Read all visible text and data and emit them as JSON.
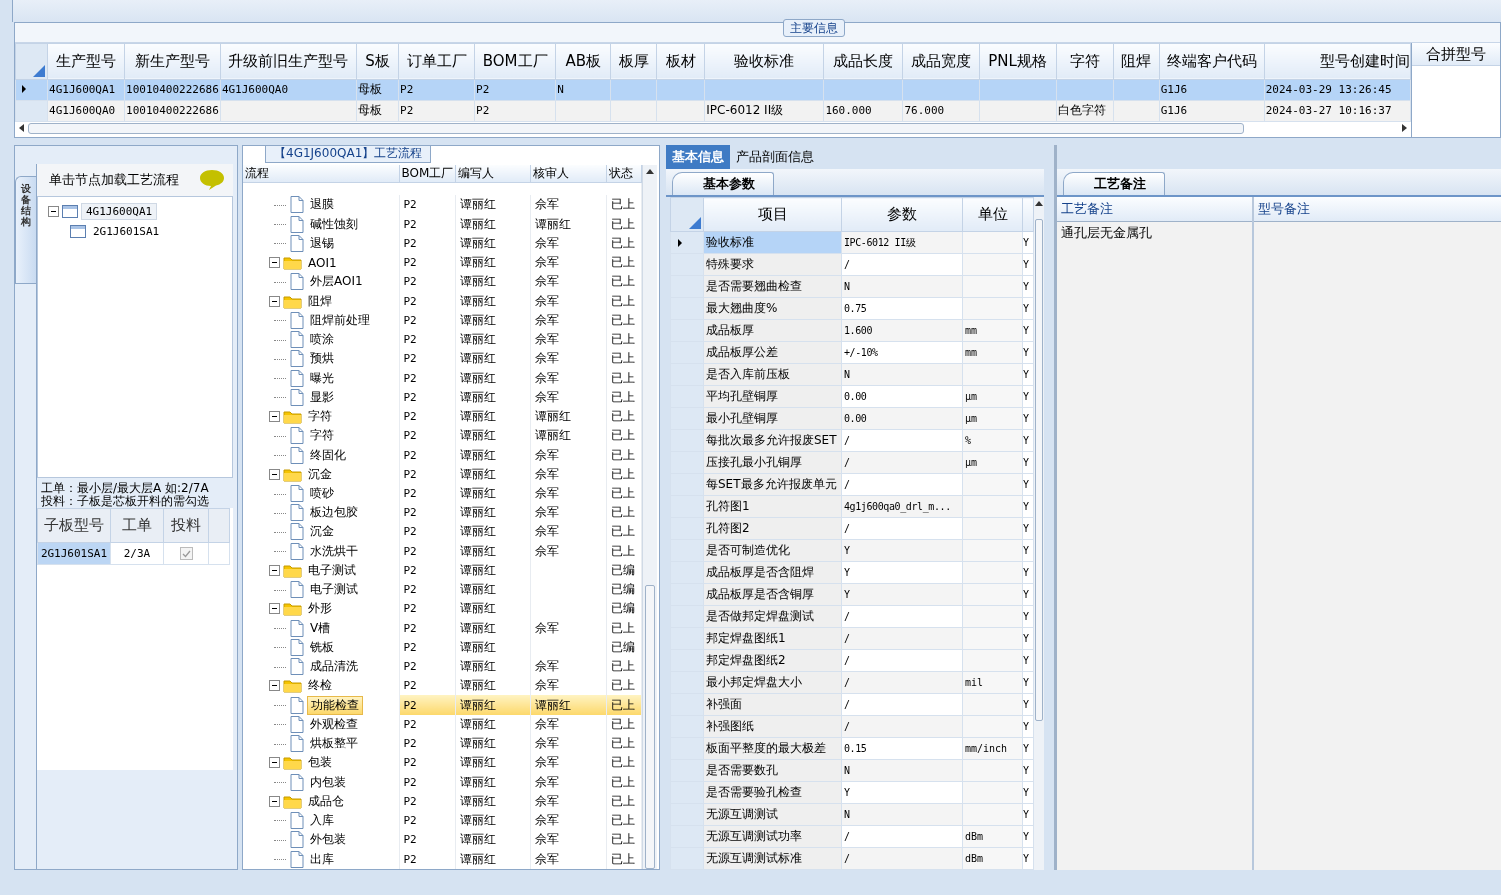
{
  "main_info": {
    "title": "主要信息",
    "columns": [
      "生产型号",
      "新生产型号",
      "升级前旧生产型号",
      "S板",
      "订单工厂",
      "BOM工厂",
      "AB板",
      "板厚",
      "板材",
      "验收标准",
      "成品长度",
      "成品宽度",
      "PNL规格",
      "字符",
      "阻焊",
      "终端客户代码",
      "型号创建时间"
    ],
    "rows": [
      {
        "selected": true,
        "cells": [
          "4G1J600QA1",
          "10010400222686",
          "4G1J600QA0",
          "母板",
          "P2",
          "P2",
          "N",
          "",
          "",
          "",
          "",
          "",
          "",
          "",
          "",
          "G1J6",
          "2024-03-29 13:26:45"
        ]
      },
      {
        "selected": false,
        "cells": [
          "4G1J600QA0",
          "10010400222686",
          "",
          "母板",
          "P2",
          "P2",
          "",
          "",
          "",
          "IPC-6012 II级",
          "160.000",
          "76.000",
          "",
          "白色字符",
          "",
          "G1J6",
          "2024-03-27 10:16:37"
        ]
      }
    ]
  },
  "merge_panel": {
    "title": "合拼型号"
  },
  "structure": {
    "side_tab": "设备结构",
    "hint": "单击节点加载工艺流程",
    "tree": [
      {
        "label": "4G1J600QA1",
        "selected": true,
        "expanded": true,
        "children": [
          {
            "label": "2G1J601SA1",
            "selected": false
          }
        ]
      }
    ],
    "notes": [
      "工单：最小层/最大层A 如:2/7A",
      "投料：子板是芯板开料的需勾选"
    ],
    "sub_table": {
      "columns": [
        "子板型号",
        "工单",
        "投料"
      ],
      "rows": [
        {
          "cells": [
            "2G1J601SA1",
            "2/3A"
          ],
          "checked": true
        }
      ]
    }
  },
  "process": {
    "title": "【4G1J600QA1】工艺流程",
    "columns": [
      "流程",
      "BOM工厂",
      "编写人",
      "核审人",
      "状态"
    ],
    "rows": [
      {
        "expanded": true,
        "children": [
          {
            "name": "退膜",
            "bom": "P2",
            "writer": "谭丽红",
            "reviewer": "佘军",
            "status": "已上",
            "selected": false
          },
          {
            "name": "碱性蚀刻",
            "bom": "P2",
            "writer": "谭丽红",
            "reviewer": "谭丽红",
            "status": "已上",
            "selected": false
          },
          {
            "name": "退锡",
            "bom": "P2",
            "writer": "谭丽红",
            "reviewer": "佘军",
            "status": "已上",
            "selected": false
          }
        ]
      },
      {
        "name": "AOI1",
        "bom": "P2",
        "writer": "谭丽红",
        "reviewer": "佘军",
        "status": "已上",
        "expanded": true,
        "selected": false,
        "children": [
          {
            "name": "外层AOI1",
            "bom": "P2",
            "writer": "谭丽红",
            "reviewer": "佘军",
            "status": "已上",
            "selected": false
          }
        ]
      },
      {
        "name": "阻焊",
        "bom": "P2",
        "writer": "谭丽红",
        "reviewer": "佘军",
        "status": "已上",
        "expanded": true,
        "selected": false,
        "children": [
          {
            "name": "阻焊前处理",
            "bom": "P2",
            "writer": "谭丽红",
            "reviewer": "佘军",
            "status": "已上",
            "selected": false
          },
          {
            "name": "喷涂",
            "bom": "P2",
            "writer": "谭丽红",
            "reviewer": "佘军",
            "status": "已上",
            "selected": false
          },
          {
            "name": "预烘",
            "bom": "P2",
            "writer": "谭丽红",
            "reviewer": "佘军",
            "status": "已上",
            "selected": false
          },
          {
            "name": "曝光",
            "bom": "P2",
            "writer": "谭丽红",
            "reviewer": "佘军",
            "status": "已上",
            "selected": false
          },
          {
            "name": "显影",
            "bom": "P2",
            "writer": "谭丽红",
            "reviewer": "佘军",
            "status": "已上",
            "selected": false
          }
        ]
      },
      {
        "name": "字符",
        "bom": "P2",
        "writer": "谭丽红",
        "reviewer": "谭丽红",
        "status": "已上",
        "expanded": true,
        "selected": false,
        "children": [
          {
            "name": "字符",
            "bom": "P2",
            "writer": "谭丽红",
            "reviewer": "谭丽红",
            "status": "已上",
            "selected": false
          },
          {
            "name": "终固化",
            "bom": "P2",
            "writer": "谭丽红",
            "reviewer": "佘军",
            "status": "已上",
            "selected": false
          }
        ]
      },
      {
        "name": "沉金",
        "bom": "P2",
        "writer": "谭丽红",
        "reviewer": "佘军",
        "status": "已上",
        "expanded": true,
        "selected": false,
        "children": [
          {
            "name": "喷砂",
            "bom": "P2",
            "writer": "谭丽红",
            "reviewer": "佘军",
            "status": "已上",
            "selected": false
          },
          {
            "name": "板边包胶",
            "bom": "P2",
            "writer": "谭丽红",
            "reviewer": "佘军",
            "status": "已上",
            "selected": false
          },
          {
            "name": "沉金",
            "bom": "P2",
            "writer": "谭丽红",
            "reviewer": "佘军",
            "status": "已上",
            "selected": false
          },
          {
            "name": "水洗烘干",
            "bom": "P2",
            "writer": "谭丽红",
            "reviewer": "佘军",
            "status": "已上",
            "selected": false
          }
        ]
      },
      {
        "name": "电子测试",
        "bom": "P2",
        "writer": "谭丽红",
        "status": "已编",
        "expanded": true,
        "selected": false,
        "children": [
          {
            "name": "电子测试",
            "bom": "P2",
            "writer": "谭丽红",
            "status": "已编",
            "selected": false
          }
        ]
      },
      {
        "name": "外形",
        "bom": "P2",
        "writer": "谭丽红",
        "status": "已编",
        "expanded": true,
        "selected": false,
        "children": [
          {
            "name": "V槽",
            "bom": "P2",
            "writer": "谭丽红",
            "reviewer": "佘军",
            "status": "已上",
            "selected": false
          },
          {
            "name": "铣板",
            "bom": "P2",
            "writer": "谭丽红",
            "status": "已编",
            "selected": false
          },
          {
            "name": "成品清洗",
            "bom": "P2",
            "writer": "谭丽红",
            "reviewer": "佘军",
            "status": "已上",
            "selected": false
          }
        ]
      },
      {
        "name": "终检",
        "bom": "P2",
        "writer": "谭丽红",
        "reviewer": "佘军",
        "status": "已上",
        "expanded": true,
        "selected": false,
        "children": [
          {
            "name": "功能检查",
            "bom": "P2",
            "writer": "谭丽红",
            "reviewer": "谭丽红",
            "status": "已上",
            "selected": true
          },
          {
            "name": "外观检查",
            "bom": "P2",
            "writer": "谭丽红",
            "reviewer": "佘军",
            "status": "已上",
            "selected": false
          },
          {
            "name": "烘板整平",
            "bom": "P2",
            "writer": "谭丽红",
            "reviewer": "佘军",
            "status": "已上",
            "selected": false
          }
        ]
      },
      {
        "name": "包装",
        "bom": "P2",
        "writer": "谭丽红",
        "reviewer": "佘军",
        "status": "已上",
        "expanded": true,
        "selected": false,
        "children": [
          {
            "name": "内包装",
            "bom": "P2",
            "writer": "谭丽红",
            "reviewer": "佘军",
            "status": "已上",
            "selected": false
          }
        ]
      },
      {
        "name": "成品仓",
        "bom": "P2",
        "writer": "谭丽红",
        "reviewer": "佘军",
        "status": "已上",
        "expanded": true,
        "selected": false,
        "children": [
          {
            "name": "入库",
            "bom": "P2",
            "writer": "谭丽红",
            "reviewer": "佘军",
            "status": "已上",
            "selected": false
          },
          {
            "name": "外包装",
            "bom": "P2",
            "writer": "谭丽红",
            "reviewer": "佘军",
            "status": "已上",
            "selected": false
          },
          {
            "name": "出库",
            "bom": "P2",
            "writer": "谭丽红",
            "reviewer": "佘军",
            "status": "已上",
            "selected": false
          }
        ]
      }
    ]
  },
  "info_tabs": [
    {
      "label": "基本信息",
      "selected": true
    },
    {
      "label": "产品剖面信息",
      "selected": false
    }
  ],
  "params": {
    "tab": "基本参数",
    "columns": [
      "项目",
      "参数",
      "单位"
    ],
    "rows": [
      {
        "item": "验收标准",
        "value": "IPC-6012 II级",
        "unit": "",
        "flag": "Y",
        "selected": true
      },
      {
        "item": "特殊要求",
        "value": "/",
        "unit": "",
        "flag": "Y",
        "selected": false
      },
      {
        "item": "是否需要翘曲检查",
        "value": "N",
        "unit": "",
        "flag": "Y",
        "selected": false
      },
      {
        "item": "最大翘曲度%",
        "value": "0.75",
        "unit": "",
        "flag": "Y",
        "selected": false
      },
      {
        "item": "成品板厚",
        "value": "1.600",
        "unit": "mm",
        "flag": "Y",
        "selected": false
      },
      {
        "item": "成品板厚公差",
        "value": "+/-10%",
        "unit": "mm",
        "flag": "Y",
        "selected": false
      },
      {
        "item": "是否入库前压板",
        "value": "N",
        "unit": "",
        "flag": "Y",
        "selected": false
      },
      {
        "item": "平均孔壁铜厚",
        "value": "0.00",
        "unit": "μm",
        "flag": "Y",
        "selected": false
      },
      {
        "item": "最小孔壁铜厚",
        "value": "0.00",
        "unit": "μm",
        "flag": "Y",
        "selected": false
      },
      {
        "item": "每批次最多允许报废SET",
        "value": "/",
        "unit": "%",
        "flag": "Y",
        "selected": false
      },
      {
        "item": "压接孔最小孔铜厚",
        "value": "/",
        "unit": "μm",
        "flag": "Y",
        "selected": false
      },
      {
        "item": "每SET最多允许报废单元",
        "value": "/",
        "unit": "",
        "flag": "Y",
        "selected": false
      },
      {
        "item": "孔符图1",
        "value": "4g1j600qa0_drl_m...",
        "unit": "",
        "flag": "Y",
        "selected": false
      },
      {
        "item": "孔符图2",
        "value": "/",
        "unit": "",
        "flag": "Y",
        "selected": false
      },
      {
        "item": "是否可制造优化",
        "value": "Y",
        "unit": "",
        "flag": "Y",
        "selected": false
      },
      {
        "item": "成品板厚是否含阻焊",
        "value": "Y",
        "unit": "",
        "flag": "Y",
        "selected": false
      },
      {
        "item": "成品板厚是否含铜厚",
        "value": "Y",
        "unit": "",
        "flag": "Y",
        "selected": false
      },
      {
        "item": "是否做邦定焊盘测试",
        "value": "/",
        "unit": "",
        "flag": "Y",
        "selected": false
      },
      {
        "item": "邦定焊盘图纸1",
        "value": "/",
        "unit": "",
        "flag": "Y",
        "selected": false
      },
      {
        "item": "邦定焊盘图纸2",
        "value": "/",
        "unit": "",
        "flag": "Y",
        "selected": false
      },
      {
        "item": "最小邦定焊盘大小",
        "value": "/",
        "unit": "mil",
        "flag": "Y",
        "selected": false
      },
      {
        "item": "补强面",
        "value": "/",
        "unit": "",
        "flag": "Y",
        "selected": false
      },
      {
        "item": "补强图纸",
        "value": "/",
        "unit": "",
        "flag": "Y",
        "selected": false
      },
      {
        "item": "板面平整度的最大极差",
        "value": "0.15",
        "unit": "mm/inch",
        "flag": "Y",
        "selected": false
      },
      {
        "item": "是否需要数孔",
        "value": "N",
        "unit": "",
        "flag": "Y",
        "selected": false
      },
      {
        "item": "是否需要验孔检查",
        "value": "Y",
        "unit": "",
        "flag": "Y",
        "selected": false
      },
      {
        "item": "无源互调测试",
        "value": "N",
        "unit": "",
        "flag": "Y",
        "selected": false
      },
      {
        "item": "无源互调测试功率",
        "value": "/",
        "unit": "dBm",
        "flag": "Y",
        "selected": false
      },
      {
        "item": "无源互调测试标准",
        "value": "/",
        "unit": "dBm",
        "flag": "Y",
        "selected": false
      }
    ]
  },
  "remarks": {
    "tab": "工艺备注",
    "columns": [
      "工艺备注",
      "型号备注"
    ],
    "process_note": "通孔层无金属孔"
  }
}
